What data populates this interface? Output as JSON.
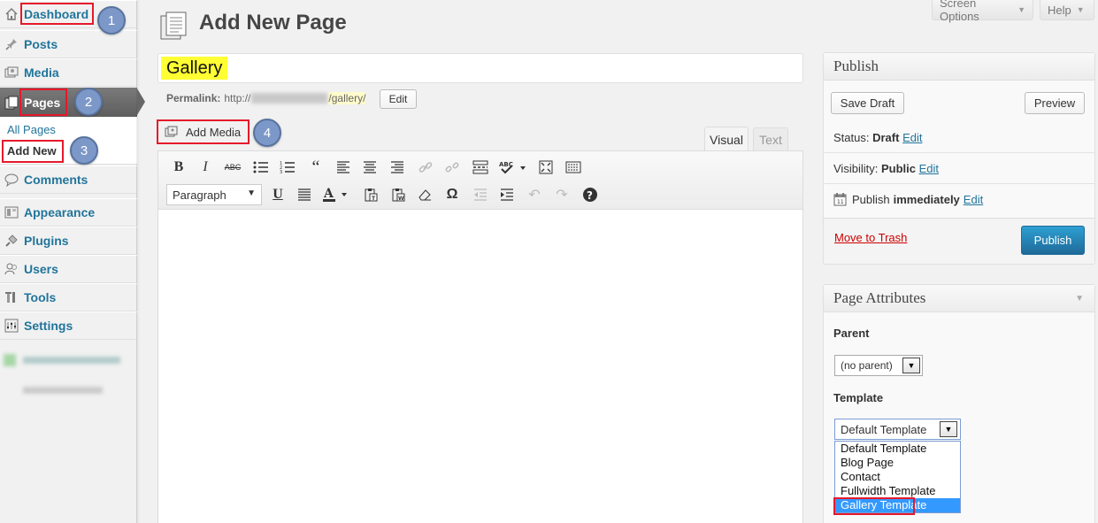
{
  "sidebar": {
    "dashboard": "Dashboard",
    "posts": "Posts",
    "media": "Media",
    "pages": "Pages",
    "all_pages": "All Pages",
    "add_new": "Add New",
    "comments": "Comments",
    "appearance": "Appearance",
    "plugins": "Plugins",
    "users": "Users",
    "tools": "Tools",
    "settings": "Settings"
  },
  "steps": [
    "1",
    "2",
    "3",
    "4"
  ],
  "header": {
    "title": "Add New Page",
    "screen_options": "Screen Options",
    "help": "Help"
  },
  "editor": {
    "post_title": "Gallery",
    "permalink_label": "Permalink:",
    "permalink_prefix": "http://",
    "permalink_slug": "/gallery/",
    "edit_label": "Edit",
    "add_media": "Add Media",
    "tab_visual": "Visual",
    "tab_text": "Text",
    "format": "Paragraph"
  },
  "publish": {
    "heading": "Publish",
    "save_draft": "Save Draft",
    "preview": "Preview",
    "status_label": "Status:",
    "status_value": "Draft",
    "visibility_label": "Visibility:",
    "visibility_value": "Public",
    "publish_label": "Publish",
    "publish_value": "immediately",
    "edit": "Edit",
    "trash": "Move to Trash",
    "publish_button": "Publish"
  },
  "attributes": {
    "heading": "Page Attributes",
    "parent_label": "Parent",
    "parent_value": "(no parent)",
    "template_label": "Template",
    "template_value": "Default Template",
    "template_options": [
      "Default Template",
      "Blog Page",
      "Contact",
      "Fullwidth Template",
      "Gallery Template"
    ]
  },
  "colors": {
    "link": "#21759b",
    "highlight": "#e5192b",
    "step_badge": "#7c98c8",
    "publish_button": "#2e8ec0",
    "title_highlight": "#ffff33"
  }
}
